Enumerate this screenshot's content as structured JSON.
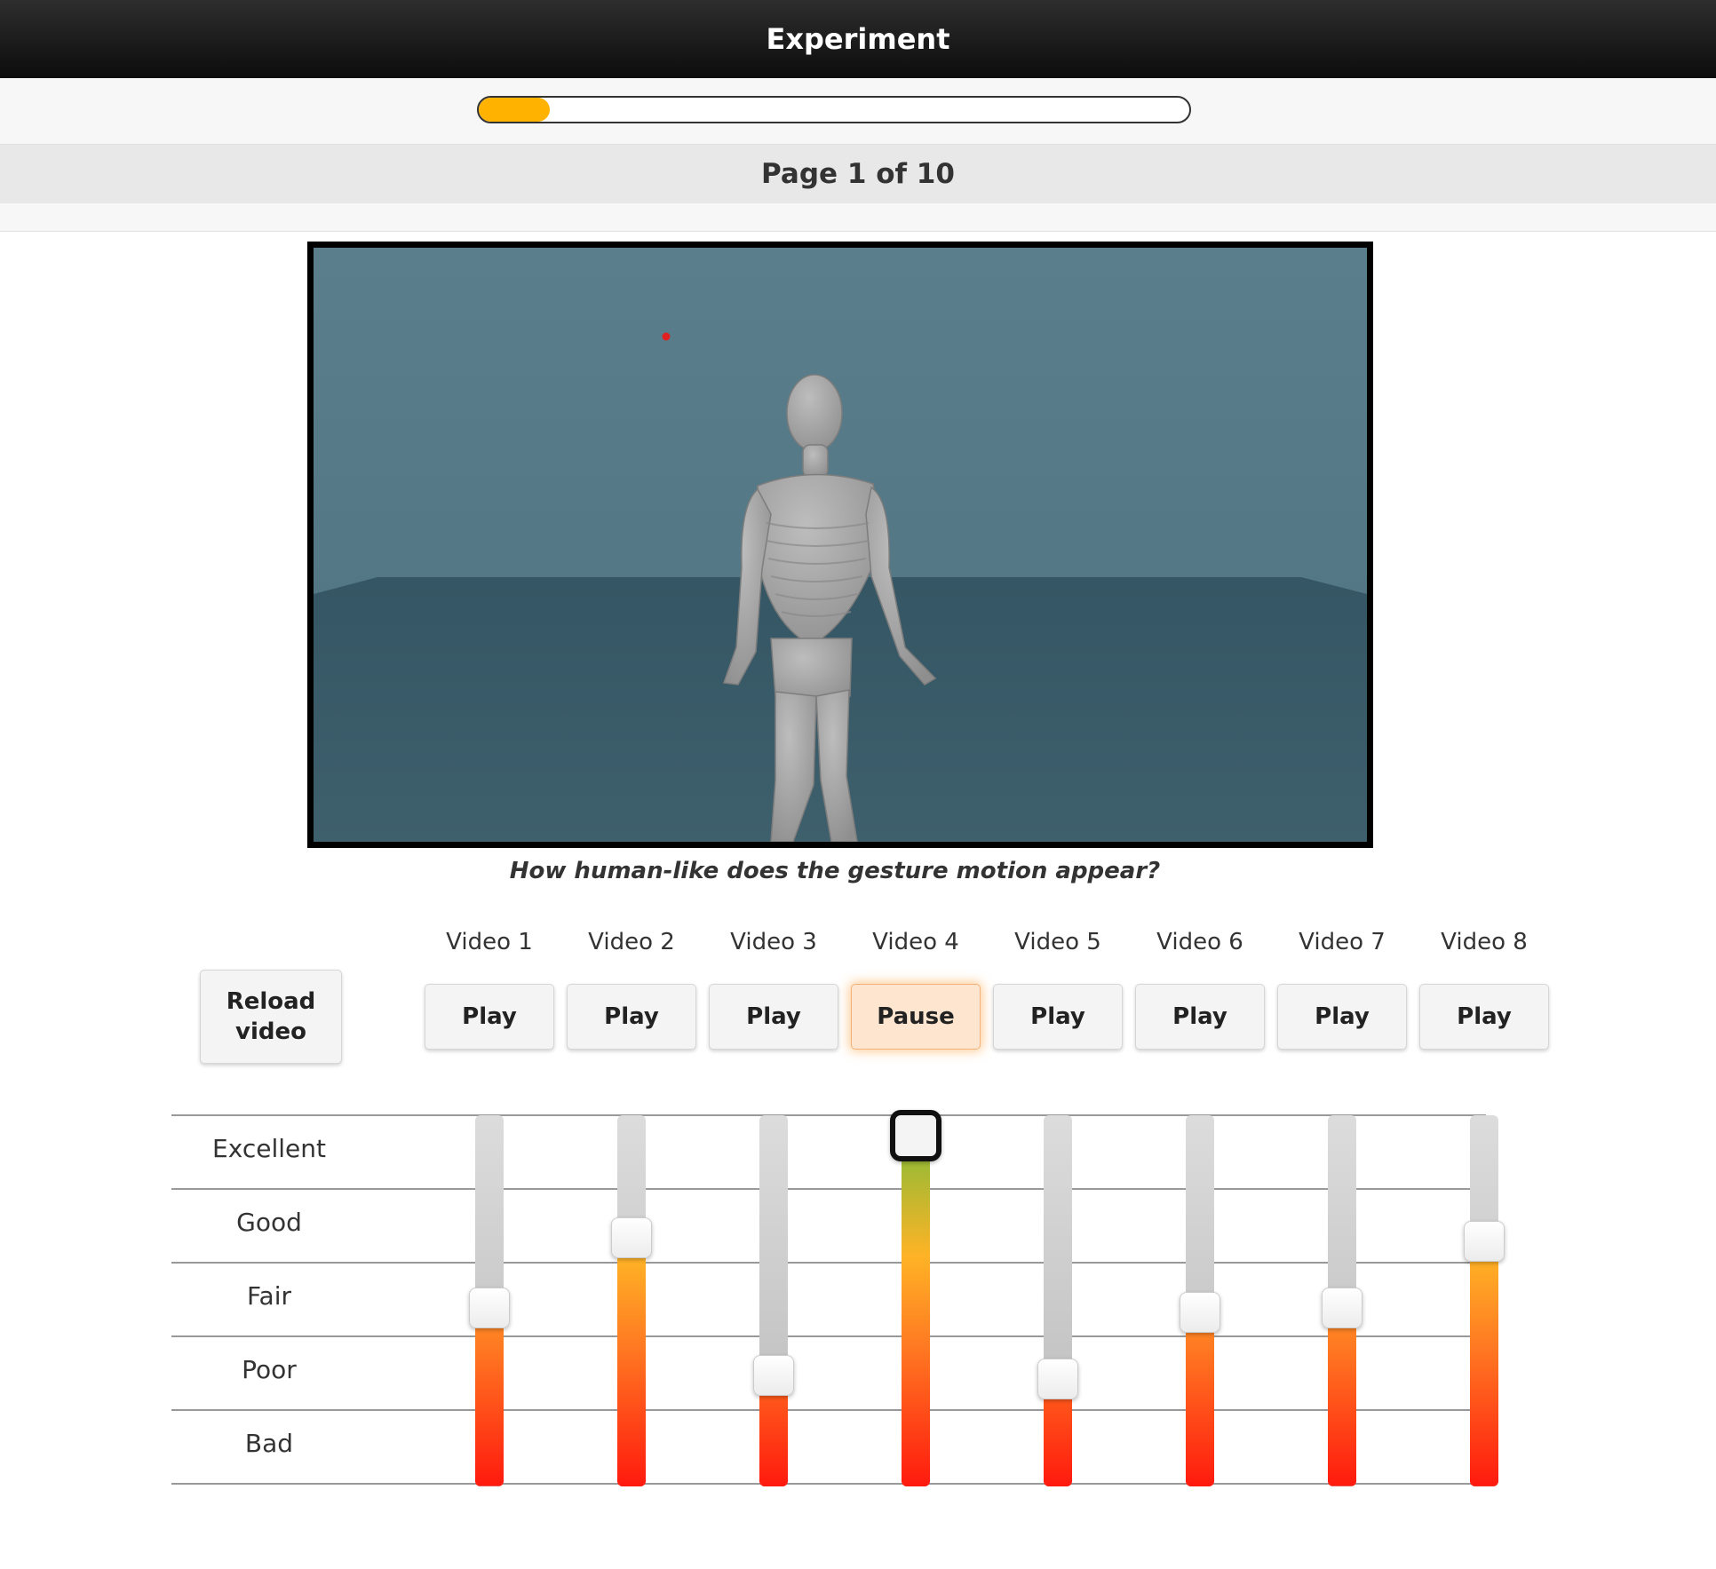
{
  "header": {
    "title": "Experiment"
  },
  "progress": {
    "fraction": 0.1
  },
  "page_indicator": "Page 1 of 10",
  "question": "How human-like does the gesture motion appear?",
  "reload_label": "Reload\nvideo",
  "videos": [
    {
      "label": "Video 1",
      "button": "Play",
      "rating": 0.48
    },
    {
      "label": "Video 2",
      "button": "Play",
      "rating": 0.67
    },
    {
      "label": "Video 3",
      "button": "Play",
      "rating": 0.3
    },
    {
      "label": "Video 4",
      "button": "Pause",
      "rating": 0.95,
      "active": true
    },
    {
      "label": "Video 5",
      "button": "Play",
      "rating": 0.29
    },
    {
      "label": "Video 6",
      "button": "Play",
      "rating": 0.47
    },
    {
      "label": "Video 7",
      "button": "Play",
      "rating": 0.48
    },
    {
      "label": "Video 8",
      "button": "Play",
      "rating": 0.66
    }
  ],
  "scale_labels": [
    "Excellent",
    "Good",
    "Fair",
    "Poor",
    "Bad"
  ],
  "colors": {
    "accent": "#ffb300",
    "active_button": "#fde5cf"
  }
}
